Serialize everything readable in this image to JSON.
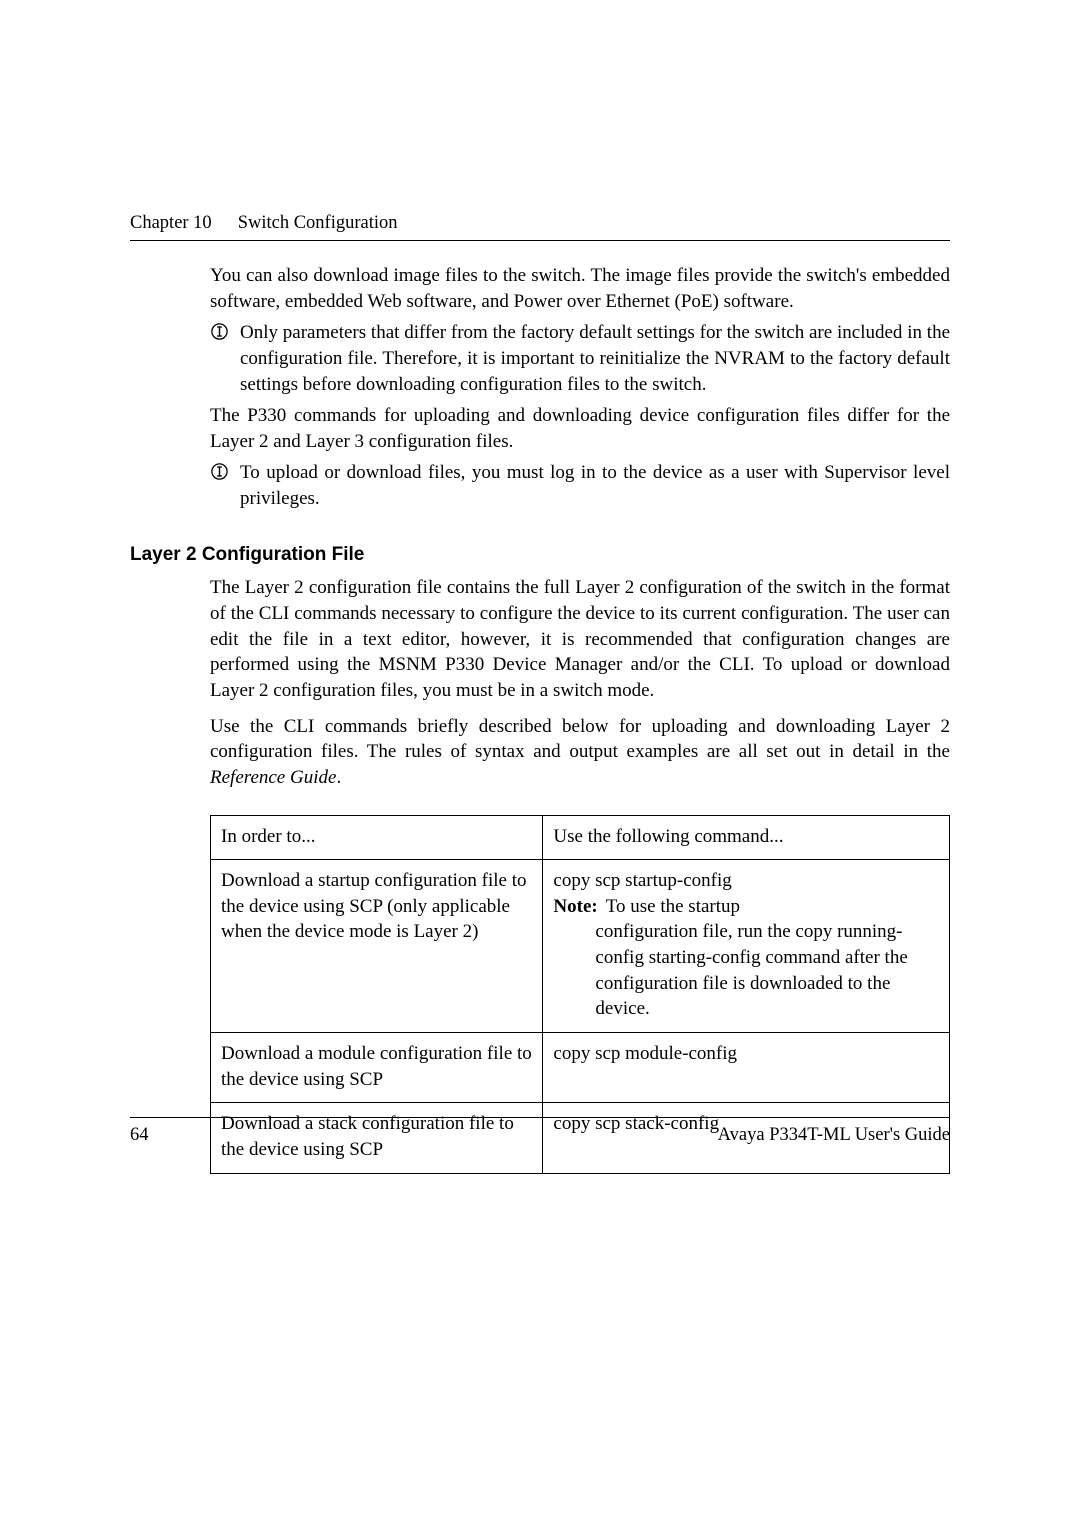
{
  "header": {
    "chapter": "Chapter 10",
    "title": "Switch Configuration"
  },
  "body": {
    "p1": "You can also download image files to the switch. The image files provide the switch's embedded software, embedded Web software, and Power over Ethernet (PoE) software.",
    "note1": "Only parameters that differ from the factory default settings for the switch are included in the configuration file. Therefore, it is important to reinitialize the NVRAM to the factory default settings before downloading configuration files to the switch.",
    "p2": "The P330 commands for uploading and downloading device configuration files differ for the Layer 2 and Layer 3 configuration files.",
    "note2": "To upload or download files, you must log in to the device as a user with Supervisor level privileges."
  },
  "section": {
    "heading": "Layer 2 Configuration File",
    "p1": "The Layer 2 configuration file contains the full Layer 2 configuration of the switch in the format of the CLI commands necessary to configure the device to its current configuration. The user can edit the file in a text editor, however, it is recommended that configuration changes are performed using the MSNM P330 Device Manager and/or the CLI. To upload or download Layer 2 configuration files, you must be in a switch mode.",
    "p2a": "Use the CLI commands briefly described below for uploading and downloading Layer 2 configuration files. The rules of syntax and output examples are all set out in detail in the ",
    "p2b_italic": "Reference Guide",
    "p2c": "."
  },
  "table": {
    "head": {
      "col1": "In order to...",
      "col2": "Use the following command..."
    },
    "rows": [
      {
        "c1": "Download a startup configuration file to the device using SCP (only applicable when the device mode is Layer 2)",
        "cmd": "copy scp startup-config",
        "note_label": "Note:",
        "note_first": "To use the startup",
        "note_rest": "configuration file, run the copy running-config starting-config command after the configuration file is downloaded to the device."
      },
      {
        "c1": "Download a module configuration file to the device using SCP",
        "cmd": "copy scp module-config"
      },
      {
        "c1": "Download a stack configuration file to the device using SCP",
        "cmd": "copy scp stack-config"
      }
    ]
  },
  "footer": {
    "page": "64",
    "guide": "Avaya P334T-ML User's Guide"
  },
  "icons": {
    "info": "info-icon"
  }
}
